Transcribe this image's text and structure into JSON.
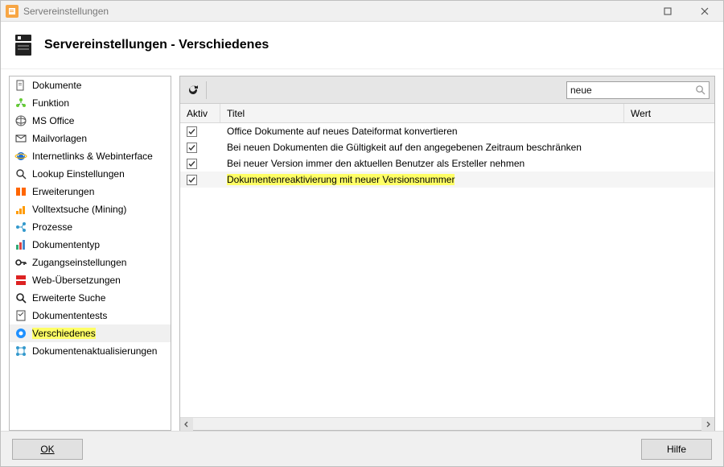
{
  "titlebar": {
    "title": "Servereinstellungen"
  },
  "header": {
    "heading": "Servereinstellungen - Verschiedenes"
  },
  "search": {
    "value": "neue"
  },
  "sidebar": {
    "items": [
      {
        "label": "Dokumente",
        "icon": "doc"
      },
      {
        "label": "Funktion",
        "icon": "func"
      },
      {
        "label": "MS Office",
        "icon": "office"
      },
      {
        "label": "Mailvorlagen",
        "icon": "mail"
      },
      {
        "label": "Internetlinks & Webinterface",
        "icon": "ie"
      },
      {
        "label": "Lookup Einstellungen",
        "icon": "lookup"
      },
      {
        "label": "Erweiterungen",
        "icon": "ext"
      },
      {
        "label": "Volltextsuche (Mining)",
        "icon": "mining"
      },
      {
        "label": "Prozesse",
        "icon": "proc"
      },
      {
        "label": "Dokumententyp",
        "icon": "doctype"
      },
      {
        "label": "Zugangseinstellungen",
        "icon": "key"
      },
      {
        "label": "Web-Übersetzungen",
        "icon": "trans"
      },
      {
        "label": "Erweiterte Suche",
        "icon": "esearch"
      },
      {
        "label": "Dokumententests",
        "icon": "tests"
      },
      {
        "label": "Verschiedenes",
        "icon": "misc",
        "selected": true,
        "highlight": true
      },
      {
        "label": "Dokumentenaktualisierungen",
        "icon": "update"
      }
    ]
  },
  "table": {
    "columns": {
      "aktiv": "Aktiv",
      "titel": "Titel",
      "wert": "Wert"
    },
    "rows": [
      {
        "aktiv": true,
        "titel": "Office Dokumente auf neues Dateiformat konvertieren"
      },
      {
        "aktiv": true,
        "titel": "Bei neuen Dokumenten die Gültigkeit auf den angegebenen Zeitraum beschränken"
      },
      {
        "aktiv": true,
        "titel": "Bei neuer Version immer den aktuellen Benutzer als Ersteller nehmen"
      },
      {
        "aktiv": true,
        "titel": "Dokumentenreaktivierung mit neuer Versionsnummer",
        "selected": true,
        "highlight": true
      }
    ]
  },
  "footer": {
    "ok": "OK",
    "help": "Hilfe"
  }
}
